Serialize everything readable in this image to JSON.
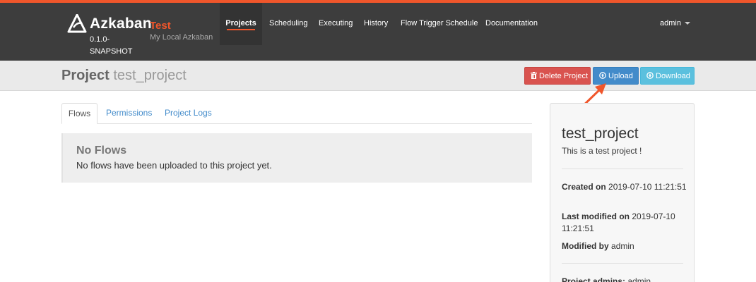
{
  "app": {
    "name": "Azkaban",
    "version": "0.1.0-SNAPSHOT",
    "env_name": "Test",
    "env_description": "My Local Azkaban",
    "logo_icon": "azkaban-logo-icon"
  },
  "colors": {
    "accent": "#f0562b",
    "navbar": "#3d3d3d",
    "danger": "#d9534f",
    "primary": "#428bca",
    "info": "#5bc0de"
  },
  "nav": {
    "items": [
      {
        "label": "Projects",
        "active": true
      },
      {
        "label": "Scheduling"
      },
      {
        "label": "Executing"
      },
      {
        "label": "History"
      },
      {
        "label": "Flow Trigger Schedule"
      },
      {
        "label": "Documentation"
      }
    ],
    "user": "admin"
  },
  "header": {
    "title_prefix": "Project",
    "title_name": "test_project",
    "buttons": {
      "delete": {
        "label": "Delete Project",
        "icon": "trash-icon"
      },
      "upload": {
        "label": "Upload",
        "icon": "upload-circle-icon"
      },
      "download": {
        "label": "Download",
        "icon": "download-circle-icon"
      }
    }
  },
  "tabs": [
    {
      "label": "Flows",
      "active": true
    },
    {
      "label": "Permissions"
    },
    {
      "label": "Project Logs"
    }
  ],
  "flows": {
    "empty_title": "No Flows",
    "empty_text": "No flows have been uploaded to this project yet."
  },
  "project_info": {
    "name": "test_project",
    "description": "This is a test project !",
    "created_label": "Created on",
    "created_value": "2019-07-10 11:21:51",
    "modified_label": "Last modified on",
    "modified_value": "2019-07-10 11:21:51",
    "modified_by_label": "Modified by",
    "modified_by_value": "admin",
    "admins_label": "Project admins:",
    "admins_value": "admin"
  },
  "annotation": {
    "icon": "red-arrow-icon",
    "color": "#f0562b"
  }
}
